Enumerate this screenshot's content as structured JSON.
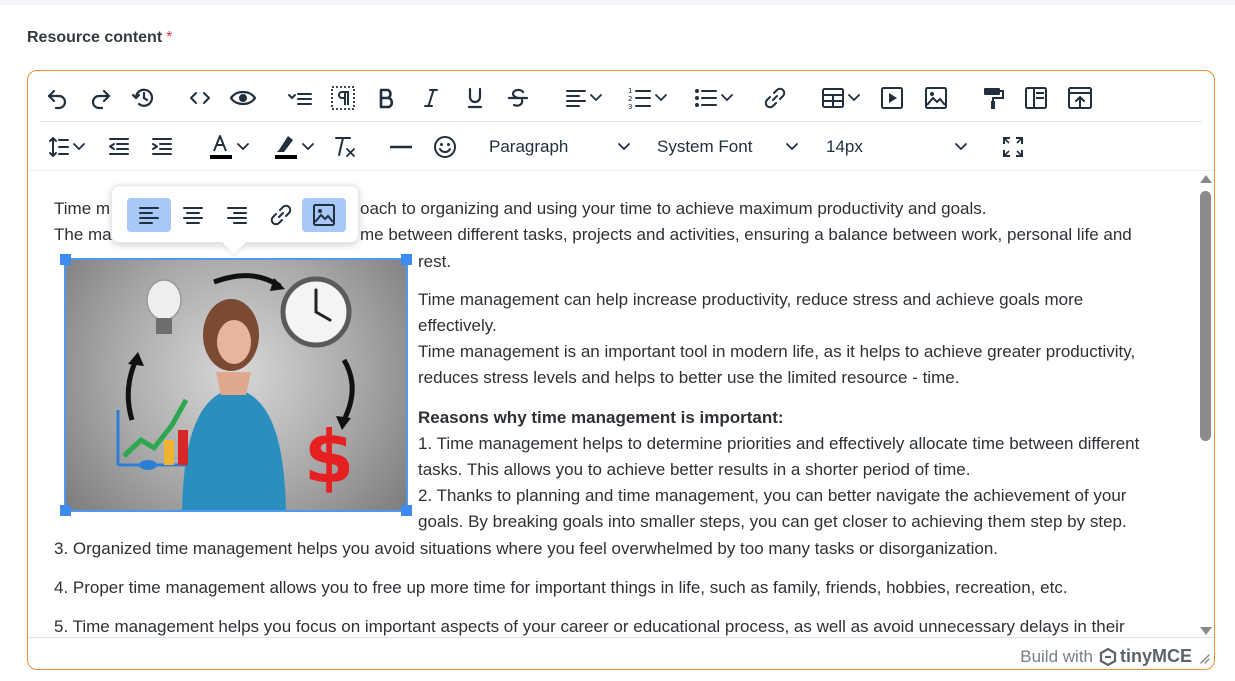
{
  "field": {
    "label": "Resource content",
    "required_mark": "*"
  },
  "toolbar": {
    "block_format": "Paragraph",
    "font_family": "System Font",
    "font_size": "14px"
  },
  "colors": {
    "accent_border": "#e8903a",
    "selection": "#4a9af4",
    "active_button": "#a8c8f7",
    "text_color_swatch": "#000000",
    "highlight_swatch": "#000000"
  },
  "content": {
    "line1": "Time management is an approach to organizing and using your time to achieve maximum productivity and goals.",
    "line1_prefix": "Time m",
    "line1_suffix": "oach to organizing and using your time to achieve maximum productivity and goals.",
    "line2_prefix": "The ma",
    "line2_suffix": "me between different tasks, projects and activities, ensuring a balance between work, personal life and",
    "line2_cont": "rest.",
    "para2_line1": "Time management can help increase productivity, reduce stress and achieve goals more",
    "para2_line2": "effectively.",
    "para2_line3": "Time management is an important tool in modern life, as it helps to achieve greater productivity,",
    "para2_line4": "reduces stress levels and helps to better use the limited resource - time.",
    "reasons_heading": "Reasons why time management is important:",
    "reason1_line1": "1. Time management helps to determine priorities and effectively allocate time between different",
    "reason1_line2": "tasks. This allows you to achieve better results in a shorter period of time.",
    "reason2_line1": "2. Thanks to planning and time management, you can better navigate the achievement of your",
    "reason2_line2": "goals. By breaking goals into smaller steps, you can get closer to achieving them step by step.",
    "reason3": "3. Organized time management helps you avoid situations where you feel overwhelmed by too many tasks or disorganization.",
    "reason4": "4. Proper time management allows you to free up more time for important things in life, such as family, friends, hobbies, recreation, etc.",
    "reason5": "5. Time management helps you focus on important aspects of your career or educational process, as well as avoid unnecessary delays in their"
  },
  "icons": {
    "row1": [
      "undo-icon",
      "redo-icon",
      "history-icon",
      "code-icon",
      "preview-icon",
      "format-list-icon",
      "visual-blocks-icon",
      "bold-icon",
      "italic-icon",
      "underline-icon",
      "strikethrough-icon",
      "align-icon",
      "numbered-list-icon",
      "bullet-list-icon",
      "link-icon",
      "table-icon",
      "media-icon",
      "image-icon",
      "format-painter-icon",
      "template-icon",
      "export-icon"
    ],
    "row2": [
      "line-height-icon",
      "outdent-icon",
      "indent-icon",
      "text-color-icon",
      "highlight-icon",
      "clear-format-icon",
      "horizontal-rule-icon",
      "emoji-icon",
      "fullscreen-icon"
    ],
    "float": [
      "align-left-icon",
      "align-center-icon",
      "align-right-icon",
      "link-icon",
      "image-icon"
    ]
  },
  "statusbar": {
    "branding_prefix": "Build with",
    "branding_name": "tinyMCE"
  }
}
